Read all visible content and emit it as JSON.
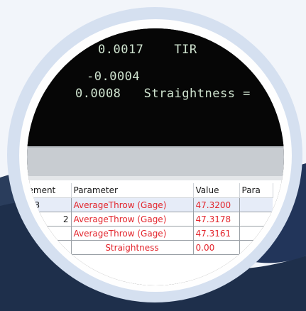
{
  "terminal": {
    "lines": [
      "0.0017    TIR",
      "-0.0004",
      "0.0008   Straightness ="
    ]
  },
  "table": {
    "headers": [
      "ement",
      "Parameter",
      "Value",
      "Para"
    ],
    "rows": [
      {
        "element": "t 3",
        "parameter": "AverageThrow (Gage)",
        "value": "47.3200"
      },
      {
        "element": "2",
        "parameter": "AverageThrow (Gage)",
        "value": "47.3178"
      },
      {
        "element": "",
        "parameter": "AverageThrow (Gage)",
        "value": "47.3161"
      },
      {
        "element": "",
        "parameter": "Straightness",
        "value": "0.00"
      }
    ]
  },
  "colors": {
    "terminal_bg": "#060606",
    "terminal_text": "#cfe3cf",
    "warning_text": "#e3262d",
    "ring_outer": "#d5e0f0",
    "navy_background": "#1e2f4b"
  }
}
